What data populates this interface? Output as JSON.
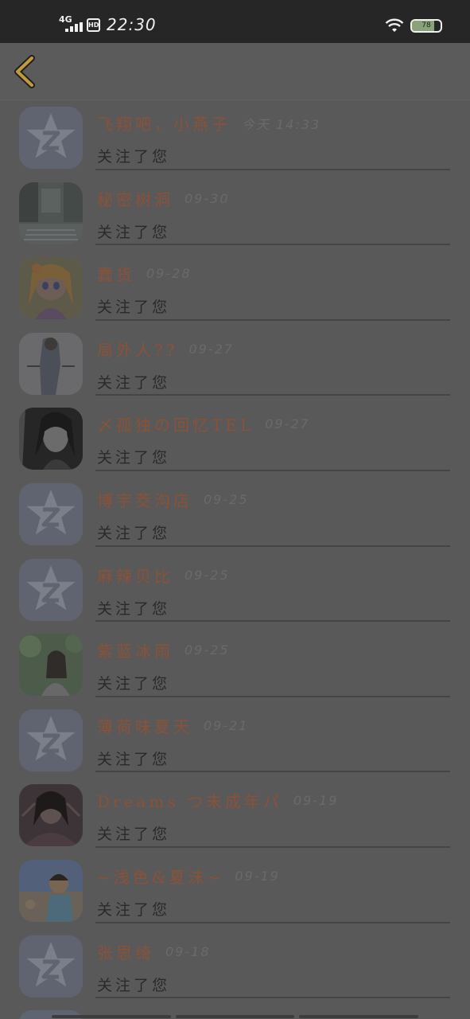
{
  "status_bar": {
    "network": "4G",
    "hd": "HD",
    "time": "22:30",
    "battery": "78",
    "battery_level": 0.78
  },
  "header": {
    "back_icon": "chevron-left-icon",
    "accent_color": "#c09a3c"
  },
  "colors": {
    "name": "#8a5238",
    "time": "#6a6a6a",
    "subtitle": "#2a2a2a"
  },
  "items": [
    {
      "name": "飞翔吧，小燕子",
      "time": "今天 14:33",
      "subtitle": "关注了您",
      "avatar": "default-star-avatar"
    },
    {
      "name": "秘密树洞",
      "time": "09-30",
      "subtitle": "关注了您",
      "avatar": "street-photo-avatar"
    },
    {
      "name": "蠢货",
      "time": "09-28",
      "subtitle": "关注了您",
      "avatar": "anime-girl-avatar"
    },
    {
      "name": "局外人??",
      "time": "09-27",
      "subtitle": "关注了您",
      "avatar": "figure-photo-avatar"
    },
    {
      "name": "〆孤独の回忆TEL",
      "time": "09-27",
      "subtitle": "关注了您",
      "avatar": "bw-portrait-avatar"
    },
    {
      "name": "博宇茭沟店",
      "time": "09-25",
      "subtitle": "关注了您",
      "avatar": "default-star-avatar"
    },
    {
      "name": "麻辣贝比",
      "time": "09-25",
      "subtitle": "关注了您",
      "avatar": "default-star-avatar"
    },
    {
      "name": "紫蓝冰雨",
      "time": "09-25",
      "subtitle": "关注了您",
      "avatar": "nature-portrait-avatar"
    },
    {
      "name": "薄荷味夏天",
      "time": "09-21",
      "subtitle": "关注了您",
      "avatar": "default-star-avatar"
    },
    {
      "name": "Dreams つ未成年パ",
      "time": "09-19",
      "subtitle": "关注了您",
      "avatar": "dark-portrait-avatar"
    },
    {
      "name": "~浅色&夏沫~",
      "time": "09-19",
      "subtitle": "关注了您",
      "avatar": "child-photo-avatar"
    },
    {
      "name": "张思绮",
      "time": "09-18",
      "subtitle": "关注了您",
      "avatar": "default-star-avatar"
    }
  ]
}
